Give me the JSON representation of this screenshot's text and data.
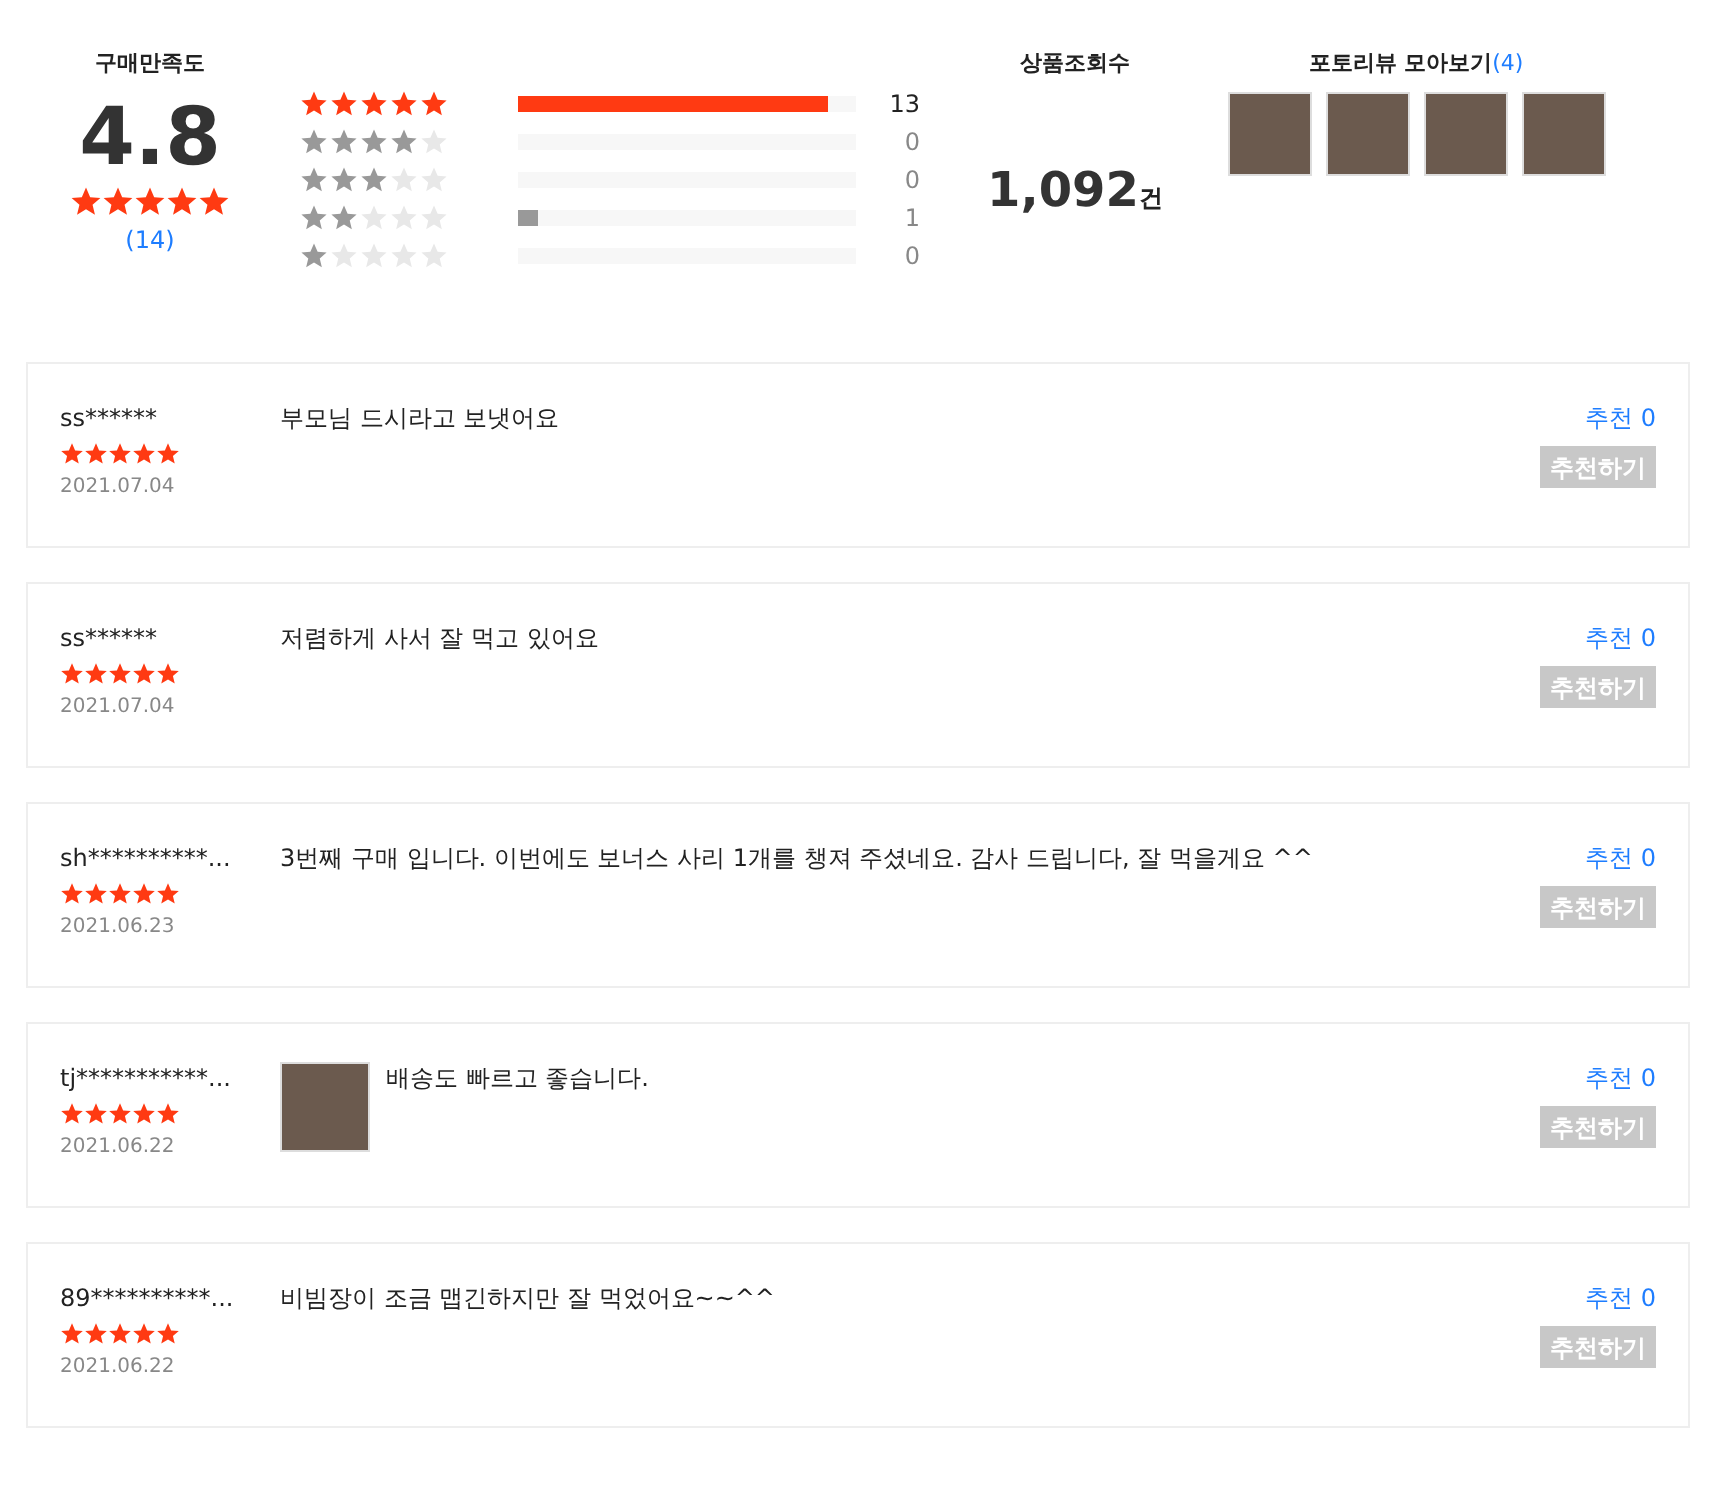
{
  "summary": {
    "label": "구매만족도",
    "score": "4.8",
    "stars": 5,
    "count": "(14)"
  },
  "distribution": [
    {
      "stars": 5,
      "level": 0.92,
      "count": "13",
      "color": "#ff3a12"
    },
    {
      "stars": 4,
      "level": 0,
      "count": "0",
      "color": "#999999"
    },
    {
      "stars": 3,
      "level": 0,
      "count": "0",
      "color": "#999999"
    },
    {
      "stars": 2,
      "level": 0.06,
      "count": "1",
      "color": "#999999"
    },
    {
      "stars": 1,
      "level": 0,
      "count": "0",
      "color": "#999999"
    }
  ],
  "views": {
    "label": "상품조회수",
    "value": "1,092",
    "unit": "건"
  },
  "photo_reviews": {
    "label": "포토리뷰 모아보기",
    "count": "(4)",
    "photos": [
      {
        "kind": "photo"
      },
      {
        "kind": "photo"
      },
      {
        "kind": "photo"
      },
      {
        "kind": "photo"
      }
    ]
  },
  "reviews": [
    {
      "user": "ss******",
      "stars": 5,
      "date": "2021.07.04",
      "text": "부모님 드시라고 보냇어요",
      "photo": false,
      "recommend": "추천 0",
      "button": "추천하기"
    },
    {
      "user": "ss******",
      "stars": 5,
      "date": "2021.07.04",
      "text": "저렴하게 사서 잘 먹고 있어요",
      "photo": false,
      "recommend": "추천 0",
      "button": "추천하기"
    },
    {
      "user": "sh**********...",
      "stars": 5,
      "date": "2021.06.23",
      "text": "3번째 구매 입니다. 이번에도 보너스 사리 1개를 챙져 주셨네요. 감사 드립니다, 잘 먹을게요 ^^",
      "photo": false,
      "recommend": "추천 0",
      "button": "추천하기"
    },
    {
      "user": "tj***********...",
      "stars": 5,
      "date": "2021.06.22",
      "text": "배송도 빠르고 좋습니다.",
      "photo": true,
      "recommend": "추천 0",
      "button": "추천하기"
    },
    {
      "user": "89**********...",
      "stars": 5,
      "date": "2021.06.22",
      "text": "비빔장이 조금 맵긴하지만 잘 먹었어요~~^^",
      "photo": false,
      "recommend": "추천 0",
      "button": "추천하기"
    }
  ]
}
